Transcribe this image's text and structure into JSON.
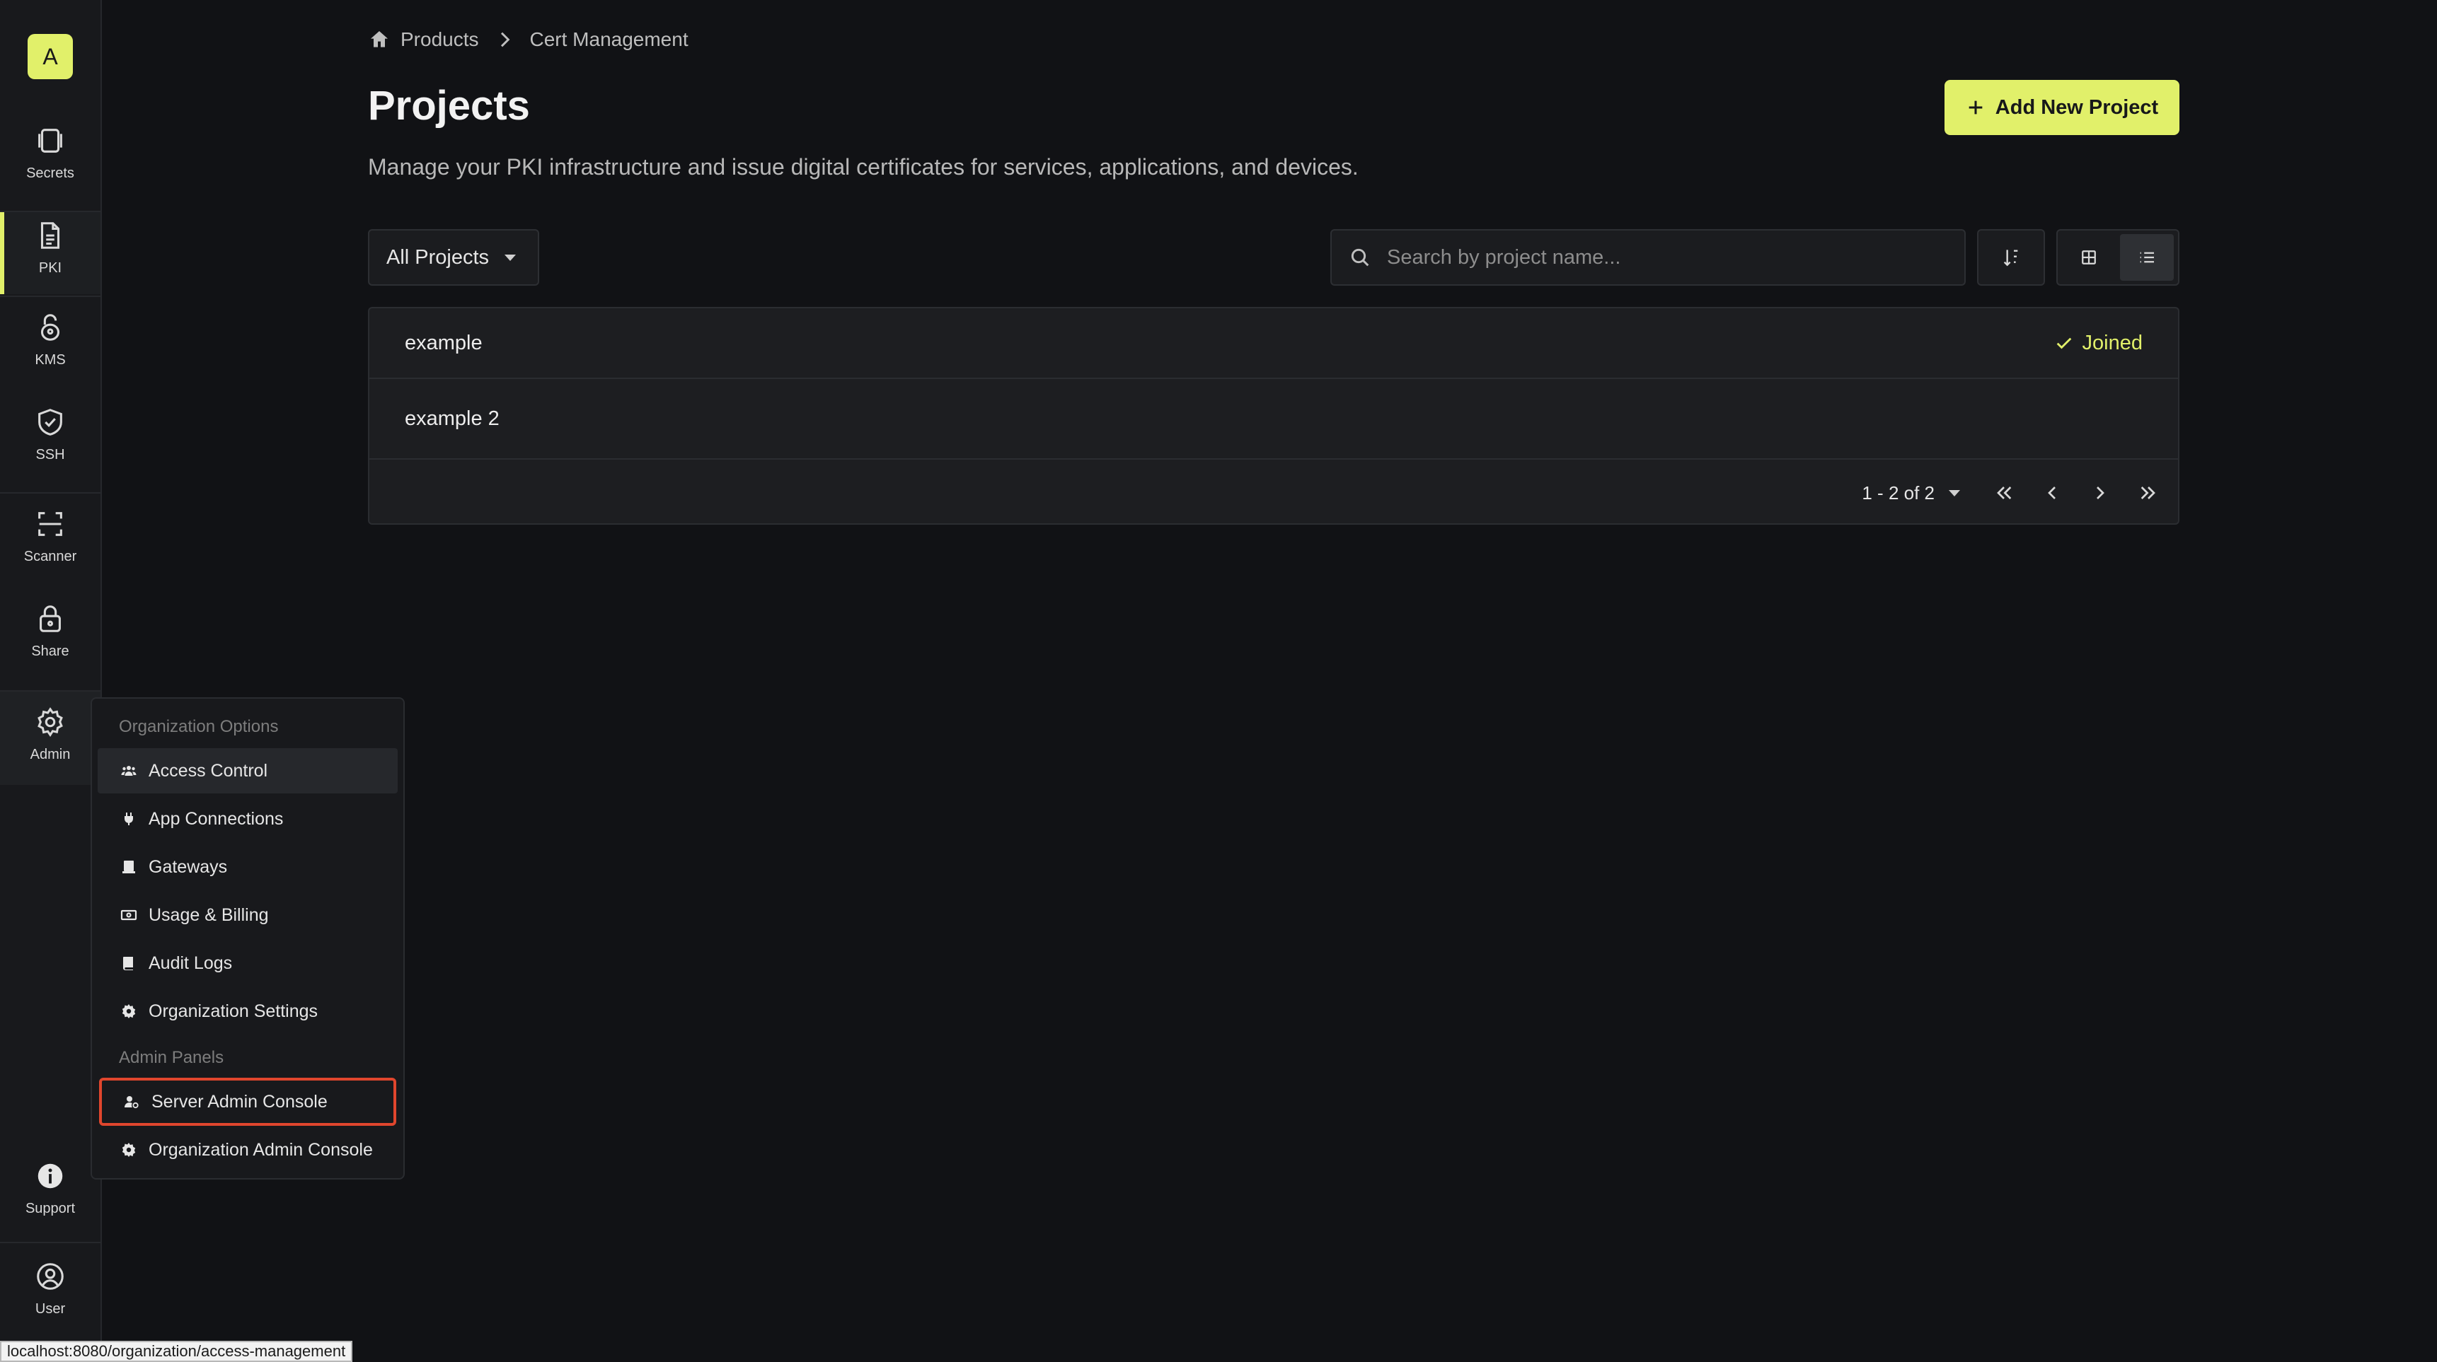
{
  "sidebar": {
    "org_initial": "A",
    "items": [
      {
        "label": "Secrets",
        "icon": "vault-icon"
      },
      {
        "label": "PKI",
        "icon": "document-icon"
      },
      {
        "label": "KMS",
        "icon": "lock-key-icon"
      },
      {
        "label": "SSH",
        "icon": "shield-check-icon"
      },
      {
        "label": "Scanner",
        "icon": "scan-icon"
      },
      {
        "label": "Share",
        "icon": "padlock-icon"
      },
      {
        "label": "Admin",
        "icon": "gear-icon"
      }
    ],
    "support_label": "Support",
    "user_label": "User",
    "active_item": "PKI",
    "accent_color": "#e1f06a"
  },
  "breadcrumb": {
    "home": "Products",
    "current": "Cert Management"
  },
  "page": {
    "title": "Projects",
    "description": "Manage your PKI infrastructure and issue digital certificates for services, applications, and devices.",
    "add_button": "Add New Project"
  },
  "toolbar": {
    "filter_label": "All Projects",
    "search_placeholder": "Search by project name...",
    "view_mode": "list"
  },
  "projects": [
    {
      "name": "example",
      "status": "Joined"
    },
    {
      "name": "example 2",
      "status": ""
    }
  ],
  "pagination": {
    "range": "1 - 2 of 2"
  },
  "admin_menu": {
    "section1": "Organization Options",
    "items1": [
      "Access Control",
      "App Connections",
      "Gateways",
      "Usage & Billing",
      "Audit Logs",
      "Organization Settings"
    ],
    "section2": "Admin Panels",
    "items2": [
      "Server Admin Console",
      "Organization Admin Console"
    ],
    "highlight_color": "#e0462d"
  },
  "status_bar": {
    "url": "localhost:8080/organization/access-management"
  }
}
